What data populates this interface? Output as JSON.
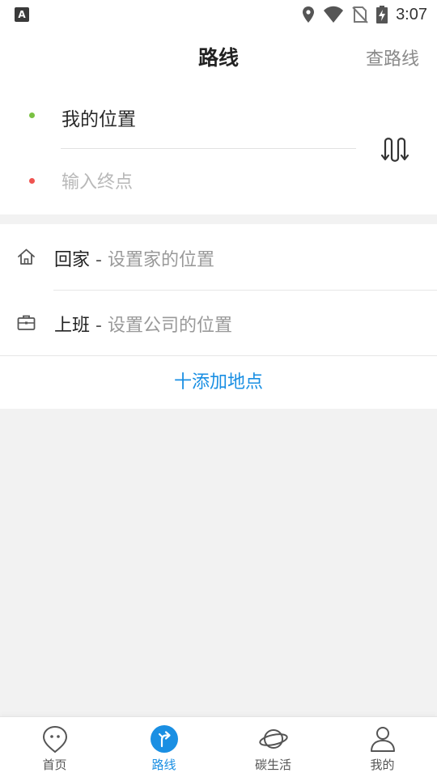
{
  "status_bar": {
    "left_icon": "keyboard-a-icon",
    "icons": [
      "location-icon",
      "wifi-icon",
      "no-sim-icon",
      "battery-charging-icon"
    ],
    "time": "3:07"
  },
  "header": {
    "title": "路线",
    "action_label": "查路线"
  },
  "route": {
    "from_text": "我的位置",
    "to_placeholder": "输入终点",
    "to_value": "",
    "swap_icon": "swap-route-icon",
    "start_color": "#7ac143",
    "end_color": "#ef5350"
  },
  "places": {
    "home": {
      "icon": "home-icon",
      "title": "回家",
      "separator": " - ",
      "hint": "设置家的位置"
    },
    "work": {
      "icon": "briefcase-icon",
      "title": "上班",
      "separator": " - ",
      "hint": "设置公司的位置"
    },
    "add_label": "十添加地点"
  },
  "bottom_nav": {
    "active": "路线",
    "accent": "#1a8fe3",
    "items": [
      {
        "label": "首页",
        "icon": "home-balloon-icon"
      },
      {
        "label": "路线",
        "icon": "route-arrow-icon"
      },
      {
        "label": "碳生活",
        "icon": "planet-icon"
      },
      {
        "label": "我的",
        "icon": "user-icon"
      }
    ]
  }
}
